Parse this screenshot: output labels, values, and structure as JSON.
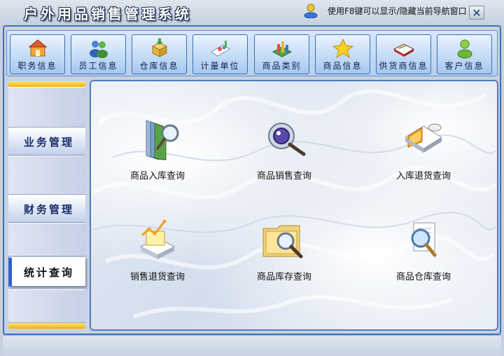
{
  "window": {
    "title": "户外用品销售管理系统",
    "close_label": "✕"
  },
  "toolbar": {
    "items": [
      {
        "label": "职务信息",
        "icon": "job-info-icon"
      },
      {
        "label": "员工信息",
        "icon": "employee-info-icon"
      },
      {
        "label": "仓库信息",
        "icon": "warehouse-info-icon"
      },
      {
        "label": "计量单位",
        "icon": "measurement-unit-icon"
      },
      {
        "label": "商品类别",
        "icon": "product-category-icon"
      },
      {
        "label": "商品信息",
        "icon": "product-info-icon"
      },
      {
        "label": "供货商信息",
        "icon": "supplier-info-icon"
      },
      {
        "label": "客户信息",
        "icon": "customer-info-icon"
      }
    ]
  },
  "sidebar": {
    "tabs": [
      {
        "label": "业务管理",
        "active": false
      },
      {
        "label": "财务管理",
        "active": false
      },
      {
        "label": "统计查询",
        "active": true
      }
    ]
  },
  "main": {
    "items": [
      {
        "label": "商品入库查询",
        "icon": "stock-in-query-icon"
      },
      {
        "label": "商品销售查询",
        "icon": "sales-query-icon"
      },
      {
        "label": "入库退货查询",
        "icon": "stock-in-return-query-icon"
      },
      {
        "label": "销售退货查询",
        "icon": "sales-return-query-icon"
      },
      {
        "label": "商品库存查询",
        "icon": "inventory-query-icon"
      },
      {
        "label": "商品仓库查询",
        "icon": "warehouse-query-icon"
      }
    ]
  },
  "status": {
    "text": "使用F8键可以显示/隐藏当前导航窗口",
    "icon": "user-icon"
  },
  "colors": {
    "accent": "#2e62c8",
    "frame": "#3f72b8",
    "gold": "#f2b000"
  }
}
